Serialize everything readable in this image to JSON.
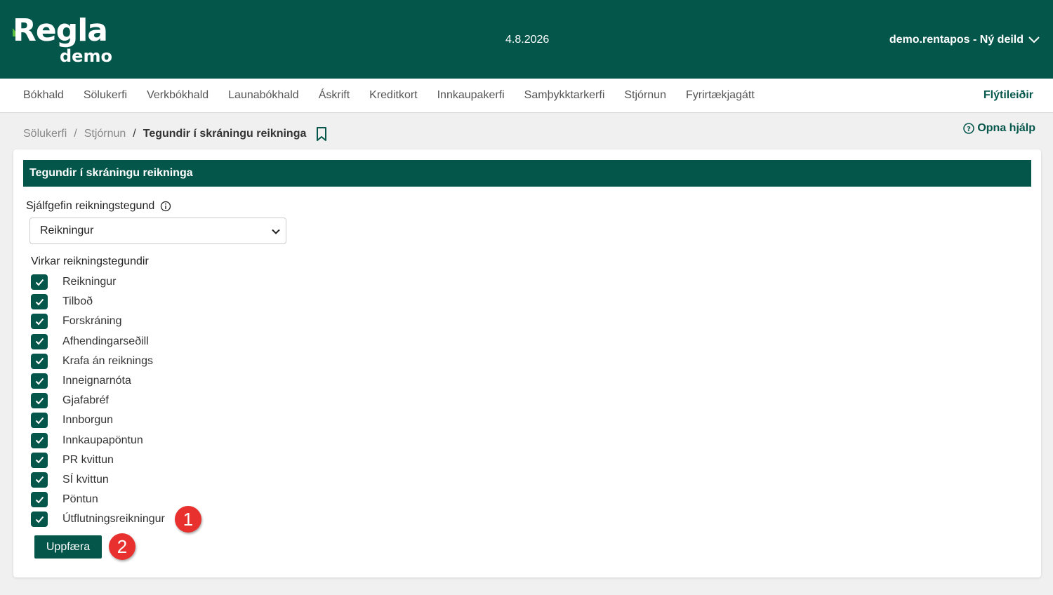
{
  "header": {
    "logo_main": "Regla",
    "logo_sub": "demo",
    "date": "4.8.2026",
    "user": "demo.rentapos - Ný deild"
  },
  "nav": {
    "items": [
      "Bókhald",
      "Sölukerfi",
      "Verkbókhald",
      "Launabókhald",
      "Áskrift",
      "Kreditkort",
      "Innkaupakerfi",
      "Samþykktarkerfi",
      "Stjórnun",
      "Fyrirtækjagátt"
    ],
    "shortcuts": "Flýtileiðir"
  },
  "breadcrumb": {
    "items": [
      "Sölukerfi",
      "Stjórnun"
    ],
    "current": "Tegundir í skráningu reikninga"
  },
  "help": {
    "label": "Opna hjálp"
  },
  "card": {
    "title": "Tegundir í skráningu reikninga",
    "default_label": "Sjálfgefin reikningstegund",
    "default_value": "Reikningur",
    "active_label": "Virkar reikningstegundir",
    "types": [
      "Reikningur",
      "Tilboð",
      "Forskráning",
      "Afhendingarseðill",
      "Krafa án reiknings",
      "Inneignarnóta",
      "Gjafabréf",
      "Innborgun",
      "Innkaupapöntun",
      "PR kvittun",
      "SÍ kvittun",
      "Pöntun",
      "Útflutningsreikningur"
    ],
    "update_label": "Uppfæra"
  },
  "markers": [
    "1",
    "2"
  ],
  "colors": {
    "brand": "#04564b",
    "accent": "#5bbd3c",
    "marker": "#e8312e"
  }
}
